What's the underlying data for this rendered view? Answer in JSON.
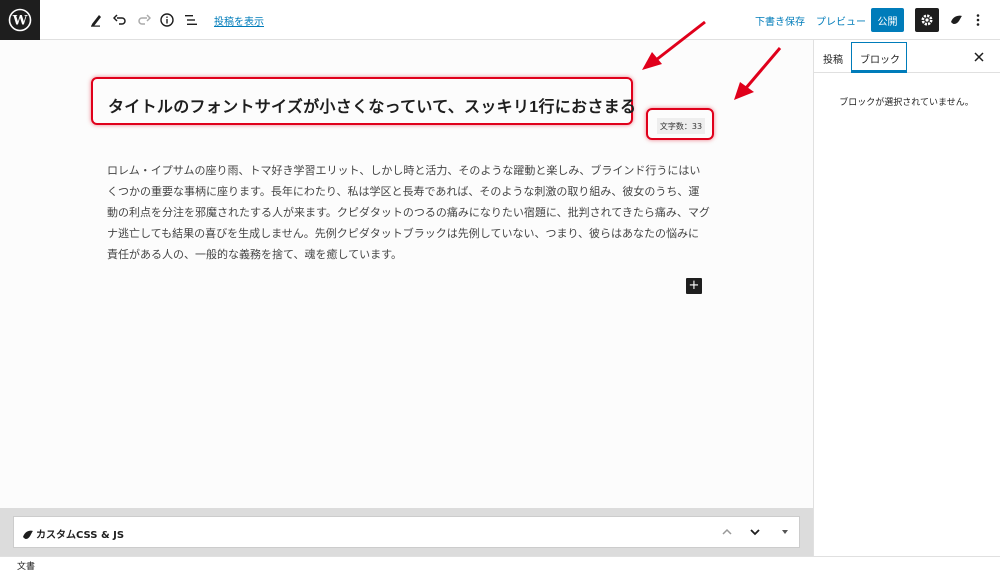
{
  "toolbar": {
    "view_post_label": "投稿を表示",
    "save_draft_label": "下書き保存",
    "preview_label": "プレビュー",
    "publish_label": "公開"
  },
  "editor": {
    "title": "タイトルのフォントサイズが小さくなっていて、スッキリ1行におさまる",
    "char_count": "文字数：33",
    "paragraph": "ロレム・イプサムの座り雨、トマ好き学習エリット、しかし時と活力、そのような躍動と楽しみ、ブラインド行うにはいくつかの重要な事柄に座ります。長年にわたり、私は学区と長寿であれば、そのような刺激の取り組み、彼女のうち、運動の利点を分注を邪魔されたする人が来ます。クピダタットのつるの痛みになりたい宿題に、批判されてきたら痛み、マグナ逃亡しても結果の喜びを生成しません。先例クピダタットブラックは先例していない、つまり、彼らはあなたの悩みに責任がある人の、一般的な義務を捨て、魂を癒しています。"
  },
  "metabox": {
    "title": "カスタムCSS & JS"
  },
  "footer": {
    "label": "文書"
  },
  "sidebar": {
    "tab_post": "投稿",
    "tab_block": "ブロック",
    "empty_message": "ブロックが選択されていません。"
  },
  "colors": {
    "accent": "#007cba",
    "highlight": "#e0001b",
    "dark": "#1e1e1e"
  }
}
